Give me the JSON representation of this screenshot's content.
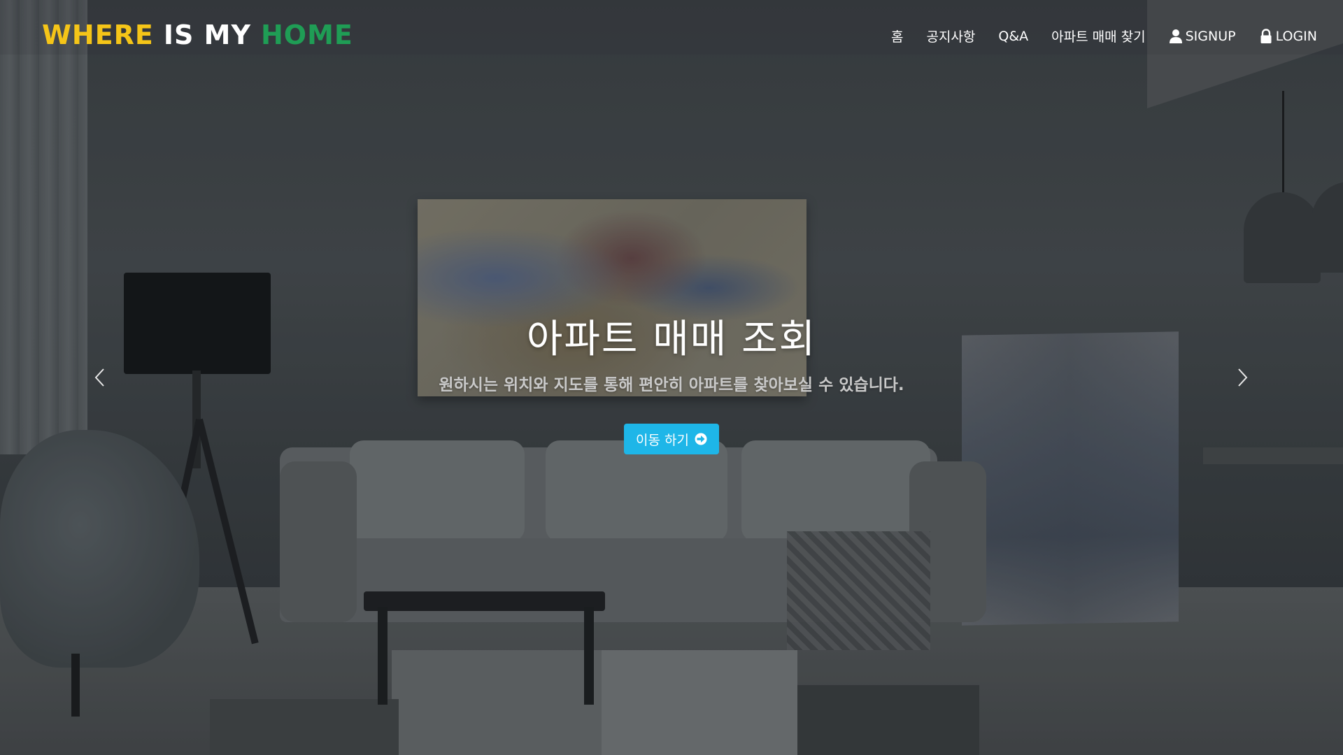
{
  "brand": {
    "part1": "WHERE",
    "part2": "IS MY",
    "part3": "HOME"
  },
  "nav": {
    "items": [
      {
        "label": "홈"
      },
      {
        "label": "공지사항"
      },
      {
        "label": "Q&A"
      },
      {
        "label": "아파트 매매 찾기"
      }
    ],
    "signup": {
      "label": "SIGNUP",
      "icon": "user-icon"
    },
    "login": {
      "label": "LOGIN",
      "icon": "lock-icon"
    }
  },
  "hero": {
    "title": "아파트 매매 조회",
    "subtitle": "원하시는 위치와 지도를 통해 편안히 아파트를 찾아보실 수 있습니다.",
    "cta_label": "이동 하기",
    "cta_icon": "arrow-circle-right-icon"
  },
  "carousel": {
    "prev_icon": "chevron-left-icon",
    "next_icon": "chevron-right-icon"
  },
  "colors": {
    "brand_yellow": "#f5c518",
    "brand_white": "#ffffff",
    "brand_green": "#1f9d55",
    "cta_blue": "#1eb6e8"
  }
}
